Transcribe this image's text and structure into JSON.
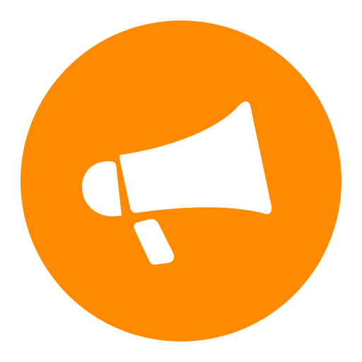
{
  "icon": {
    "name": "megaphone-icon",
    "background_color": "#FF8A00",
    "glyph_color": "#FFFFFF"
  }
}
